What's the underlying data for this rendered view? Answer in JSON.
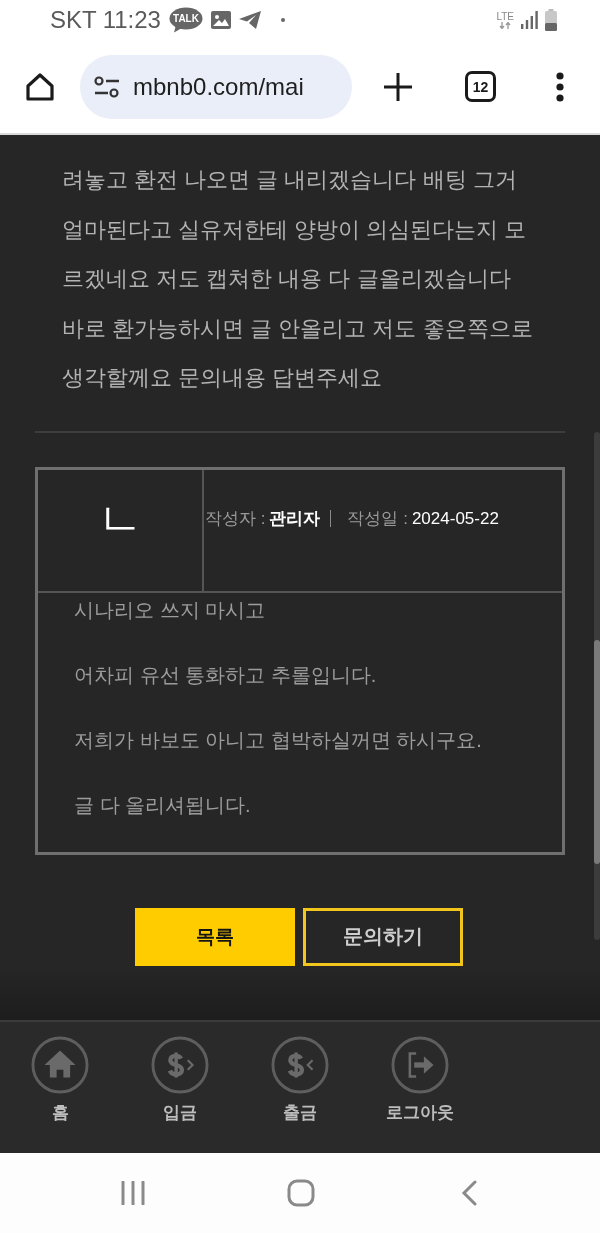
{
  "status_bar": {
    "carrier": "SKT",
    "time": "11:23",
    "chat_icon_text": "TALK",
    "network": "LTE"
  },
  "browser_toolbar": {
    "url": "mbnb0.com/mai",
    "tab_count": "12"
  },
  "post": {
    "body_lines": [
      "려놓고 환전 나오면 글 내리겠습니다 배팅 그거",
      "얼마된다고 실유저한테 양방이 의심된다는지 모",
      "르겠네요 저도 캡쳐한 내용 다 글올리겠습니다",
      "바로 환가능하시면 글 안올리고 저도 좋은쪽으로",
      "생각할께요 문의내용 답변주세요"
    ]
  },
  "reply": {
    "marker": "ㄴ",
    "author_label": "작성자 :",
    "author": "관리자",
    "date_label": "작성일 :",
    "date": "2024-05-22",
    "paragraphs": [
      "시나리오 쓰지 마시고",
      "어차피 유선 통화하고 추롤입니다.",
      "저희가 바보도 아니고 협박하실꺼면 하시구요.",
      "글 다 올리셔됩니다."
    ]
  },
  "buttons": [
    {
      "label": "목록",
      "kind": "filled"
    },
    {
      "label": "문의하기",
      "kind": "outline"
    }
  ],
  "bottom_nav": [
    {
      "label": "홈",
      "kind": "home"
    },
    {
      "label": "입금",
      "kind": "deposit"
    },
    {
      "label": "출금",
      "kind": "withdraw"
    },
    {
      "label": "로그아웃",
      "kind": "logout"
    }
  ]
}
